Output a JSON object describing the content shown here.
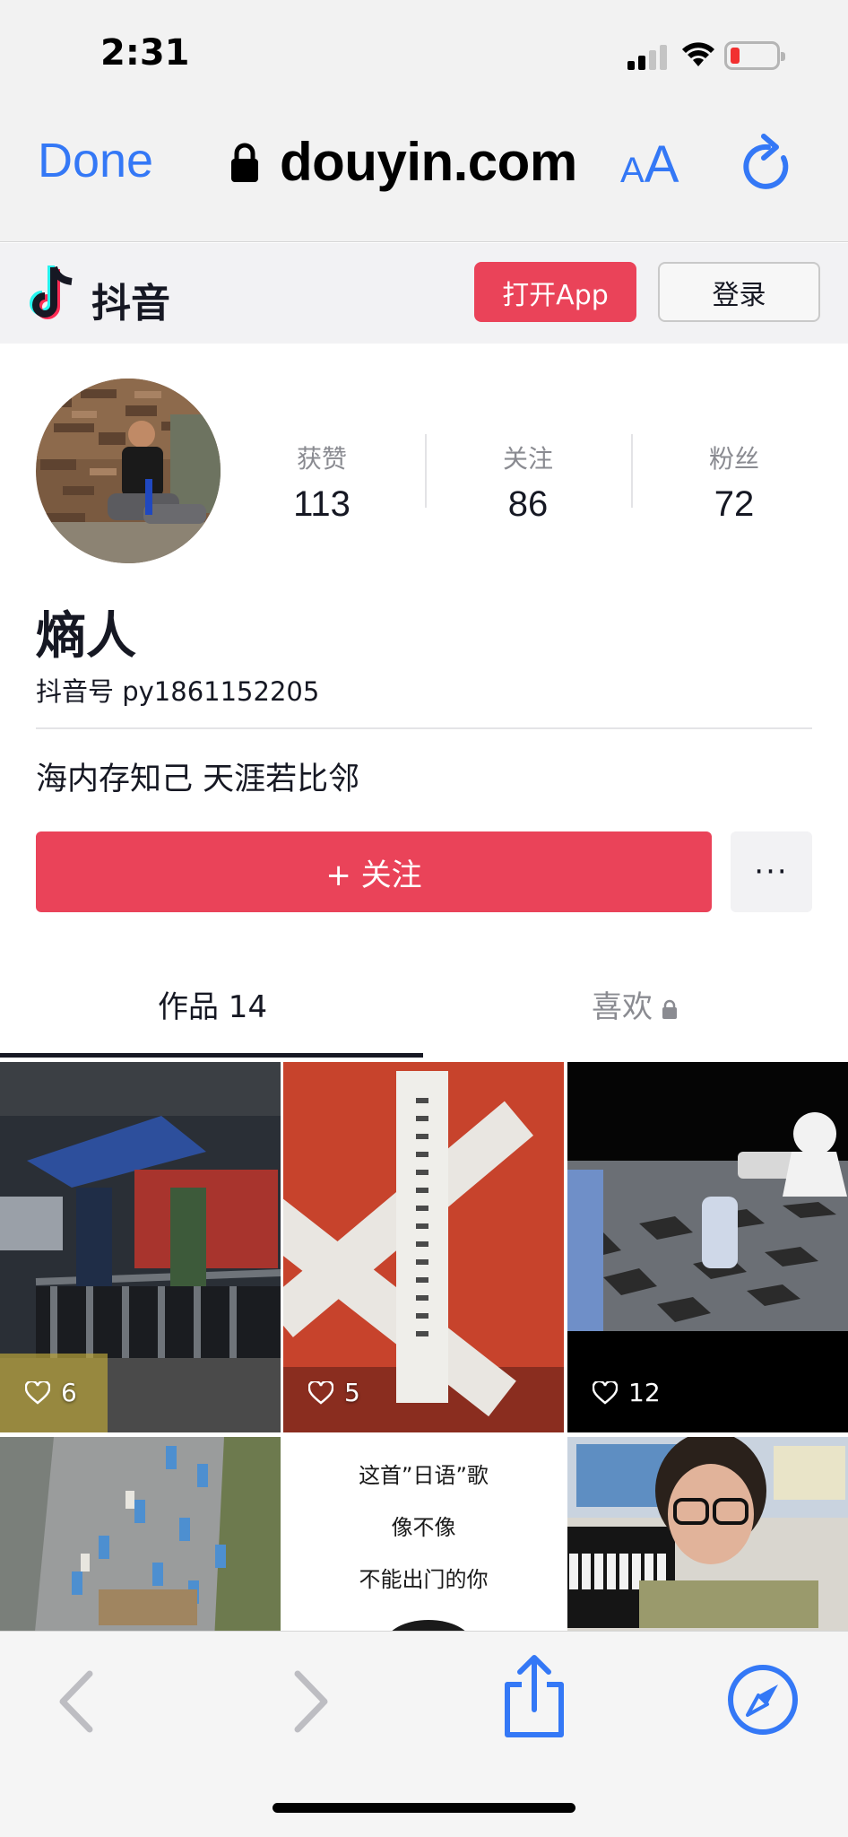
{
  "status_bar": {
    "time": "2:31"
  },
  "browser": {
    "done_label": "Done",
    "url": "douyin.com",
    "text_size_label_small": "A",
    "text_size_label_big": "A"
  },
  "site_header": {
    "brand_name": "抖音",
    "open_app_label": "打开App",
    "login_label": "登录"
  },
  "profile": {
    "stats": [
      {
        "label": "获赞",
        "value": "113"
      },
      {
        "label": "关注",
        "value": "86"
      },
      {
        "label": "粉丝",
        "value": "72"
      }
    ],
    "nickname": "熵人",
    "douyin_id": "抖音号 py1861152205",
    "bio": "海内存知己 天涯若比邻",
    "follow_label": "+ 关注",
    "more_label": "···"
  },
  "tabs": {
    "works_label": "作品 14",
    "likes_label": "喜欢"
  },
  "videos": [
    {
      "likes": "6"
    },
    {
      "likes": "5"
    },
    {
      "likes": "12"
    },
    {
      "likes": ""
    },
    {
      "likes": "",
      "caption_lines": [
        "这首”日语”歌",
        "像不像",
        "不能出门的你"
      ]
    },
    {
      "likes": ""
    }
  ],
  "colors": {
    "accent": "#ea4359",
    "safari_blue": "#3478f6",
    "text": "#161823",
    "muted": "#8a8b91"
  }
}
